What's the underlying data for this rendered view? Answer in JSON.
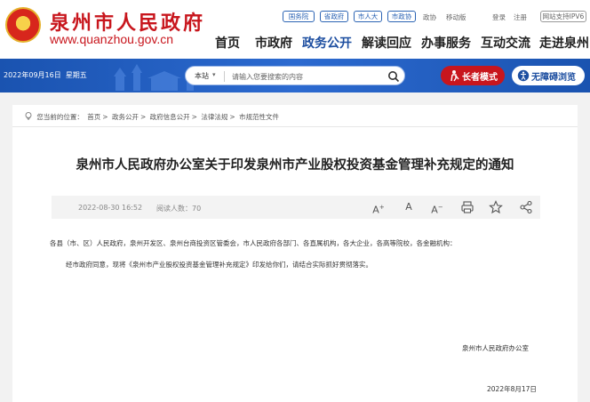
{
  "header": {
    "site_title": "泉州市人民政府",
    "site_url": "www.quanzhou.gov.cn",
    "pills": [
      "国务院",
      "省政府",
      "市人大",
      "市政协"
    ],
    "links": [
      "政协",
      "移动版",
      "登录",
      "注册"
    ],
    "ipv6": "网站支持IPV6",
    "nav": [
      "首页",
      "市政府",
      "政务公开",
      "解读回应",
      "办事服务",
      "互动交流",
      "走进泉州"
    ],
    "active_nav": "政务公开"
  },
  "banner": {
    "date": "2022年09月16日",
    "weekday": "星期五",
    "search_scope": "本站",
    "search_placeholder": "请输入您要搜索的内容",
    "elder_mode": "长者模式",
    "accessible": "无障碍浏览"
  },
  "article": {
    "breadcrumb_prefix": "您当前的位置：",
    "breadcrumb": [
      "首页",
      "政务公开",
      "政府信息公开",
      "法律法规",
      "市规范性文件"
    ],
    "title": "泉州市人民政府办公室关于印发泉州市产业股权投资基金管理补充规定的通知",
    "date": "2022-08-30 16:52",
    "read_label": "阅读人数：70",
    "paragraph1": "各县（市、区）人民政府，泉州开发区、泉州台商投资区管委会，市人民政府各部门、各直属机构，各大企业，各高等院校，各金融机构：",
    "paragraph2": "经市政府同意，现将《泉州市产业股权投资基金管理补充规定》印发给你们，请结合实际抓好贯彻落实。",
    "signature": "泉州市人民政府办公室",
    "sign_date": "2022年8月17日"
  },
  "colors": {
    "brand_red": "#c8161d",
    "brand_blue": "#1d4ea0"
  },
  "icons": [
    "national-emblem-icon",
    "search-icon",
    "elder-icon",
    "accessibility-icon",
    "location-icon",
    "font-larger-icon",
    "font-normal-icon",
    "font-smaller-icon",
    "print-icon",
    "favorite-icon",
    "share-icon"
  ]
}
